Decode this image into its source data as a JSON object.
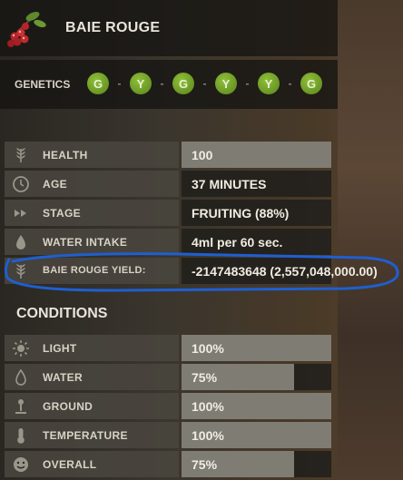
{
  "header": {
    "title": "BAIE ROUGE",
    "icon": "berry-plant-icon"
  },
  "genetics": {
    "label": "GENETICS",
    "genes": [
      "G",
      "Y",
      "G",
      "Y",
      "Y",
      "G"
    ],
    "color": "#7aa82e"
  },
  "stats": [
    {
      "label": "HEALTH",
      "value": "100",
      "icon": "wheat-icon",
      "fill": 1.0
    },
    {
      "label": "AGE",
      "value": "37 MINUTES",
      "icon": "clock-icon"
    },
    {
      "label": "STAGE",
      "value": "FRUITING (88%)",
      "icon": "fast-forward-icon"
    },
    {
      "label": "WATER INTAKE",
      "value": "4ml per 60 sec.",
      "icon": "water-drop-icon"
    },
    {
      "label": "BAIE ROUGE YIELD:",
      "value": "-2147483648 (2,557,048,000.00)",
      "icon": "wheat-icon"
    }
  ],
  "conditions": {
    "title": "CONDITIONS",
    "items": [
      {
        "label": "LIGHT",
        "value": "100%",
        "icon": "sun-icon",
        "fill": 1.0
      },
      {
        "label": "WATER",
        "value": "75%",
        "icon": "water-drop-icon",
        "fill": 0.75
      },
      {
        "label": "GROUND",
        "value": "100%",
        "icon": "ground-probe-icon",
        "fill": 1.0
      },
      {
        "label": "TEMPERATURE",
        "value": "100%",
        "icon": "thermometer-icon",
        "fill": 1.0
      },
      {
        "label": "OVERALL",
        "value": "75%",
        "icon": "smiley-icon",
        "fill": 0.75
      }
    ]
  },
  "annotation": {
    "color": "#1f5fd0"
  }
}
